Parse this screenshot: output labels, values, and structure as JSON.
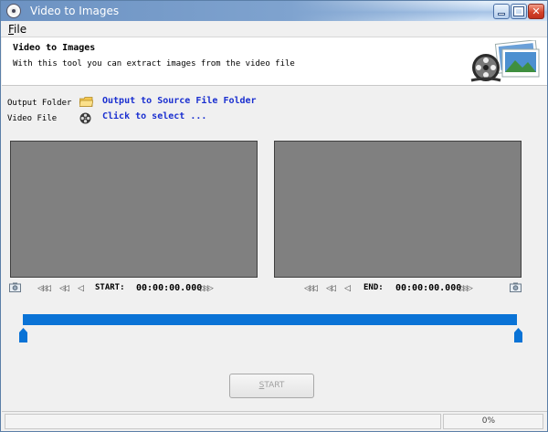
{
  "window": {
    "title": "Video to Images"
  },
  "menu": {
    "items": [
      {
        "label_u": "F",
        "label_rest": "ile"
      }
    ]
  },
  "header": {
    "title": "Video to Images",
    "description": "With this tool you can extract images from the video file",
    "art_icon": "film-reel-photos-icon"
  },
  "fields": {
    "output_folder": {
      "label": "Output Folder",
      "value": "Output to Source File Folder",
      "icon": "folder-icon"
    },
    "video_file": {
      "label": "Video File",
      "value": "Click to select ...",
      "icon": "film-reel-icon"
    }
  },
  "controls": {
    "start": {
      "label": "START:",
      "time": "00:00:00.000",
      "buttons": [
        "<<<",
        "<<",
        "<",
        ">",
        ">>",
        ">>>"
      ]
    },
    "end": {
      "label": "END:",
      "time": "00:00:00.000",
      "buttons": [
        "<<<",
        "<<",
        "<",
        ">",
        ">>",
        ">>>"
      ]
    },
    "snapshot_icon": "camera-icon"
  },
  "range": {
    "start_fraction": 0.0,
    "end_fraction": 1.0,
    "accent": "#0a73d6"
  },
  "start_button": {
    "label_u": "S",
    "label_rest": "TART",
    "enabled": false
  },
  "status": {
    "message": "",
    "progress": "0%"
  }
}
